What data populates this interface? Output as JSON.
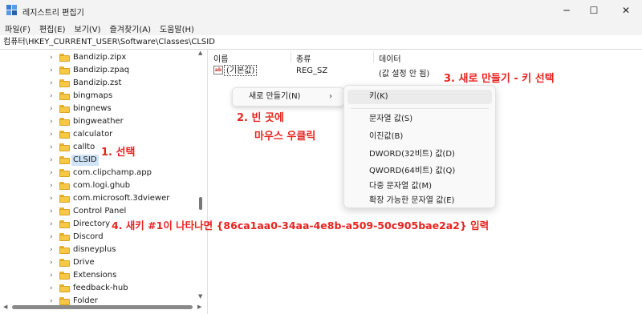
{
  "window": {
    "title": "레지스트리 편집기",
    "minimize": "─",
    "maximize": "☐",
    "close": "✕"
  },
  "menu": [
    "파일(F)",
    "편집(E)",
    "보기(V)",
    "즐겨찾기(A)",
    "도움말(H)"
  ],
  "address": "컴퓨터\\HKEY_CURRENT_USER\\Software\\Classes\\CLSID",
  "tree": {
    "items": [
      {
        "label": "Bandizip.zipx",
        "expandable": true,
        "selected": false
      },
      {
        "label": "Bandizip.zpaq",
        "expandable": true,
        "selected": false
      },
      {
        "label": "Bandizip.zst",
        "expandable": true,
        "selected": false
      },
      {
        "label": "bingmaps",
        "expandable": true,
        "selected": false
      },
      {
        "label": "bingnews",
        "expandable": true,
        "selected": false
      },
      {
        "label": "bingweather",
        "expandable": true,
        "selected": false
      },
      {
        "label": "calculator",
        "expandable": true,
        "selected": false
      },
      {
        "label": "callto",
        "expandable": true,
        "selected": false
      },
      {
        "label": "CLSID",
        "expandable": true,
        "selected": true
      },
      {
        "label": "com.clipchamp.app",
        "expandable": true,
        "selected": false
      },
      {
        "label": "com.logi.ghub",
        "expandable": true,
        "selected": false
      },
      {
        "label": "com.microsoft.3dviewer",
        "expandable": true,
        "selected": false
      },
      {
        "label": "Control Panel",
        "expandable": true,
        "selected": false
      },
      {
        "label": "Directory",
        "expandable": true,
        "selected": false
      },
      {
        "label": "Discord",
        "expandable": true,
        "selected": false
      },
      {
        "label": "disneyplus",
        "expandable": true,
        "selected": false
      },
      {
        "label": "Drive",
        "expandable": true,
        "selected": false
      },
      {
        "label": "Extensions",
        "expandable": true,
        "selected": false
      },
      {
        "label": "feedback-hub",
        "expandable": true,
        "selected": false
      },
      {
        "label": "Folder",
        "expandable": true,
        "selected": false
      }
    ]
  },
  "values_pane": {
    "columns": {
      "name": "이름",
      "type": "종류",
      "data": "데이터"
    },
    "rows": [
      {
        "icon": "ab",
        "name": "(기본값)",
        "type": "REG_SZ",
        "data": "(값 설정 안 됨)"
      }
    ]
  },
  "context_menu": {
    "new_label": "새로 만들기(N)",
    "arrow": "›"
  },
  "submenu": {
    "key": "키(K)",
    "items": [
      "문자열 값(S)",
      "이진값(B)",
      "DWORD(32비트) 값(D)",
      "QWORD(64비트) 값(Q)",
      "다중 문자열 값(M)",
      "확장 가능한 문자열 값(E)"
    ]
  },
  "annotations": {
    "step1": "1. 선택",
    "step2_line1": "2. 빈 곳에",
    "step2_line2": "마우스 우클릭",
    "step3": "3. 새로 만들기 - 키 선택",
    "step4": "4. 새키 #1이 나타나면 {86ca1aa0-34aa-4e8b-a509-50c905bae2a2} 입력"
  },
  "colors": {
    "annotation": "#e8231f",
    "selection": "#cfe4f7",
    "folder": "#f5c848"
  }
}
